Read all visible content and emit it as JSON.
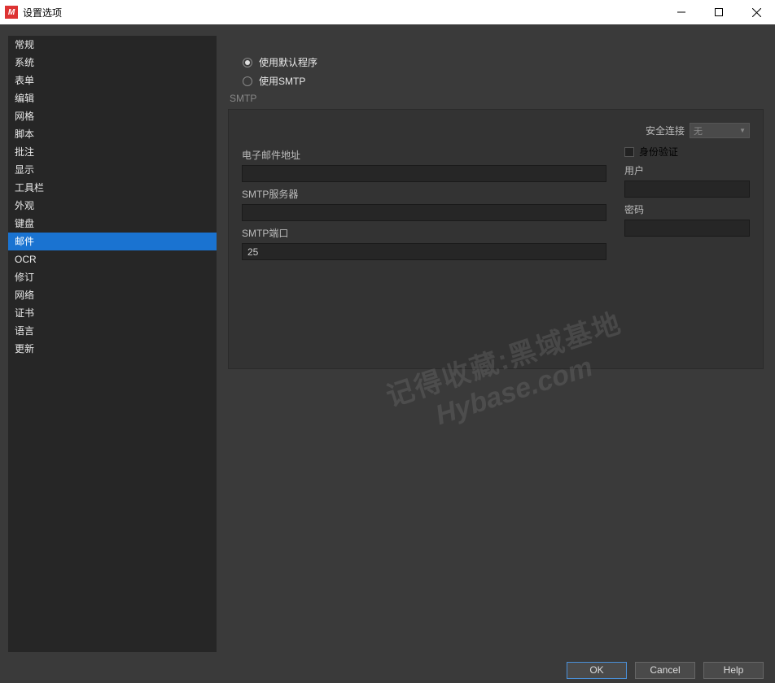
{
  "window": {
    "title": "设置选项"
  },
  "sidebar": {
    "items": [
      {
        "label": "常规"
      },
      {
        "label": "系统"
      },
      {
        "label": "表单"
      },
      {
        "label": "编辑"
      },
      {
        "label": "网格"
      },
      {
        "label": "脚本"
      },
      {
        "label": "批注"
      },
      {
        "label": "显示"
      },
      {
        "label": "工具栏"
      },
      {
        "label": "外观"
      },
      {
        "label": "键盘"
      },
      {
        "label": "邮件"
      },
      {
        "label": "OCR"
      },
      {
        "label": "修订"
      },
      {
        "label": "网络"
      },
      {
        "label": "证书"
      },
      {
        "label": "语言"
      },
      {
        "label": "更新"
      }
    ],
    "active_index": 11
  },
  "mail": {
    "radio_default": "使用默认程序",
    "radio_smtp": "使用SMTP",
    "radio_selected": "default",
    "section_label": "SMTP",
    "secure_label": "安全连接",
    "secure_value": "无",
    "email_label": "电子邮件地址",
    "email_value": "",
    "server_label": "SMTP服务器",
    "server_value": "",
    "port_label": "SMTP端口",
    "port_value": "25",
    "auth_label": "身份验证",
    "user_label": "用户",
    "user_value": "",
    "pass_label": "密码",
    "pass_value": ""
  },
  "watermark": {
    "cn": "记得收藏:黑域基地",
    "en": "Hybase.com"
  },
  "buttons": {
    "ok": "OK",
    "cancel": "Cancel",
    "help": "Help"
  }
}
